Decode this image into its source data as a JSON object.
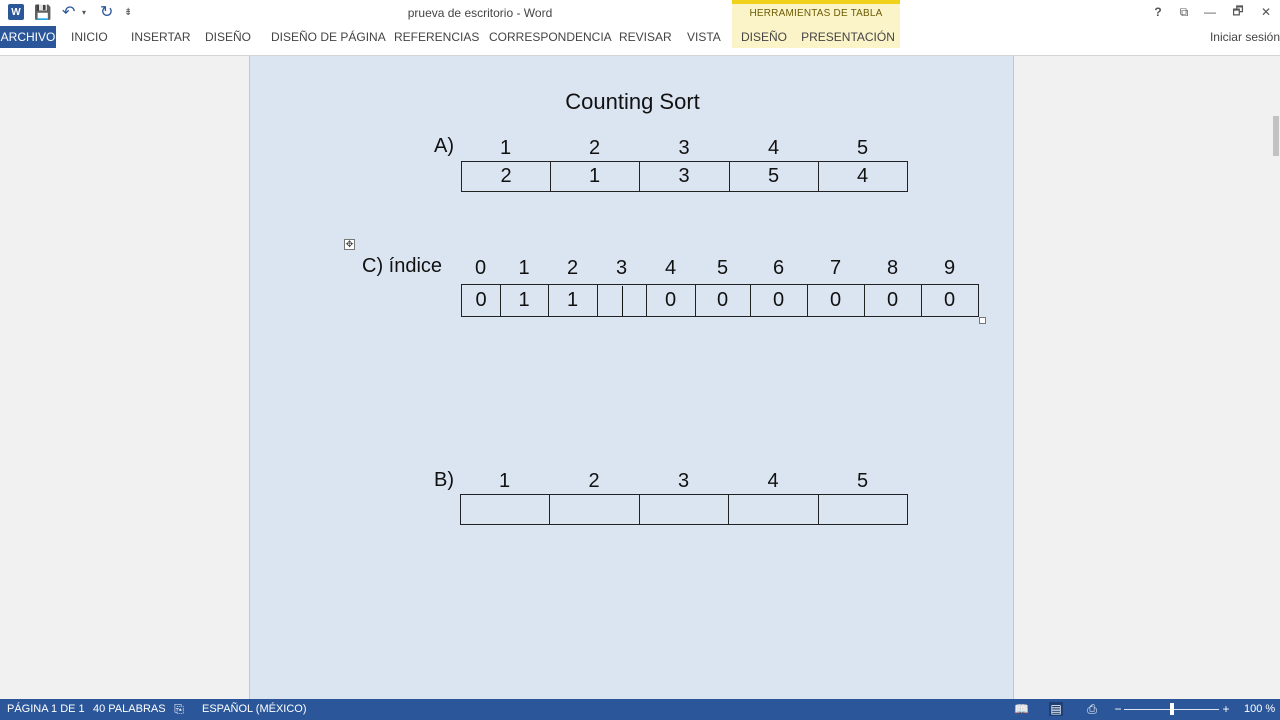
{
  "titlebar": {
    "logo_glyph": "W",
    "save_icon_glyph": "💾",
    "undo_icon_glyph": "↶",
    "undo_drop_glyph": "▾",
    "redo_icon_glyph": "↻",
    "qat_custom_glyph": "⇟",
    "document_title": "prueva de escritorio - Word",
    "context_group": "HERRAMIENTAS DE TABLA",
    "help_glyph": "?",
    "ribbon_options_glyph": "⧉",
    "minimize_glyph": "—",
    "restore_glyph": "🗗",
    "close_glyph": "✕"
  },
  "ribbon": {
    "tabs": [
      {
        "label": "ARCHIVO"
      },
      {
        "label": "INICIO"
      },
      {
        "label": "INSERTAR"
      },
      {
        "label": "DISEÑO"
      },
      {
        "label": "DISEÑO DE PÁGINA"
      },
      {
        "label": "REFERENCIAS"
      },
      {
        "label": "CORRESPONDENCIA"
      },
      {
        "label": "REVISAR"
      },
      {
        "label": "VISTA"
      },
      {
        "label": "DISEÑO"
      },
      {
        "label": "PRESENTACIÓN"
      }
    ],
    "signin": "Iniciar sesión"
  },
  "document": {
    "heading": "Counting Sort",
    "move_handle_glyph": "✥",
    "section_a": {
      "label": "A)",
      "indices": [
        "1",
        "2",
        "3",
        "4",
        "5"
      ],
      "values": [
        "2",
        "1",
        "3",
        "5",
        "4"
      ]
    },
    "section_c": {
      "label": "C) índice",
      "indices": [
        "0",
        "1",
        "2",
        "3",
        "4",
        "5",
        "6",
        "7",
        "8",
        "9"
      ],
      "values": [
        "0",
        "1",
        "1",
        "",
        "0",
        "0",
        "0",
        "0",
        "0",
        "0"
      ]
    },
    "section_b": {
      "label": "B)",
      "indices": [
        "1",
        "2",
        "3",
        "4",
        "5"
      ],
      "values": [
        "",
        "",
        "",
        "",
        ""
      ]
    }
  },
  "statusbar": {
    "page_info": "PÁGINA 1 DE 1",
    "word_count": "40 PALABRAS",
    "proofing_glyph": "⎘",
    "language": "ESPAÑOL (MÉXICO)",
    "read_mode_glyph": "📖",
    "print_layout_glyph": "▤",
    "web_layout_glyph": "⎙",
    "zoom_out_glyph": "−",
    "zoom_in_glyph": "+",
    "zoom_level": "100 %",
    "zoom_fraction": 0.5
  },
  "colors": {
    "brand": "#2b579a",
    "context_tab_bg": "#fbf4c9",
    "context_tab_accent": "#f2d11a",
    "page_shading": "#dbe5f1"
  }
}
